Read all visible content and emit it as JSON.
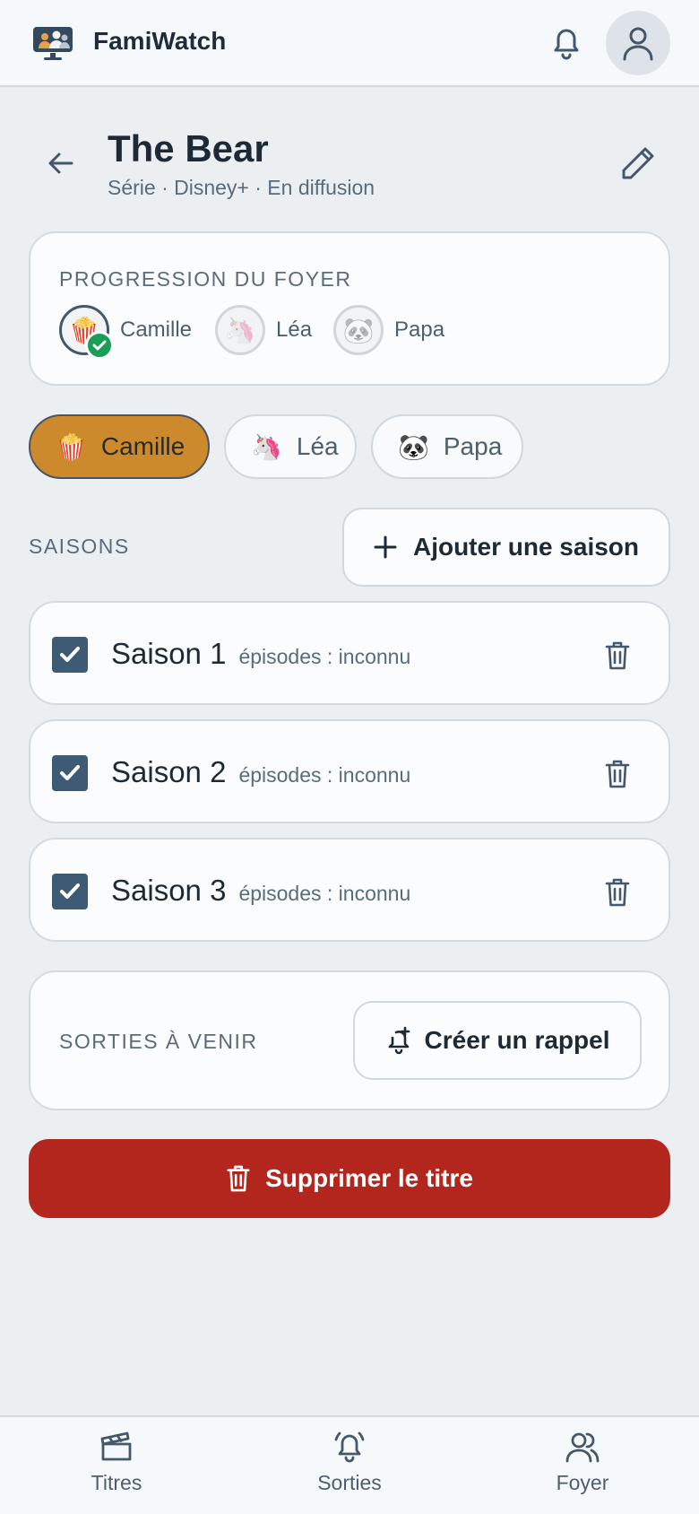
{
  "app": {
    "name": "FamiWatch"
  },
  "icons": {
    "logo": "family-tv-icon",
    "notifications": "bell-icon",
    "profile": "user-icon",
    "back": "arrow-left-icon",
    "edit": "pencil-icon"
  },
  "title": {
    "name": "The Bear",
    "meta": "Série · Disney+ · En diffusion"
  },
  "progress": {
    "label": "PROGRESSION DU FOYER",
    "members": [
      {
        "name": "Camille",
        "emoji": "🍿",
        "done": true
      },
      {
        "name": "Léa",
        "emoji": "🦄",
        "done": false
      },
      {
        "name": "Papa",
        "emoji": "🐼",
        "done": false
      }
    ]
  },
  "profiles": [
    {
      "name": "Camille",
      "emoji": "🍿",
      "selected": true
    },
    {
      "name": "Léa",
      "emoji": "🦄",
      "selected": false
    },
    {
      "name": "Papa",
      "emoji": "🐼",
      "selected": false
    }
  ],
  "seasons": {
    "label": "SAISONS",
    "add_label": "Ajouter une saison",
    "items": [
      {
        "name": "Saison 1",
        "episodes": "épisodes : inconnu",
        "checked": true
      },
      {
        "name": "Saison 2",
        "episodes": "épisodes : inconnu",
        "checked": true
      },
      {
        "name": "Saison 3",
        "episodes": "épisodes : inconnu",
        "checked": true
      }
    ]
  },
  "upcoming": {
    "label": "SORTIES À VENIR",
    "reminder_label": "Créer un rappel"
  },
  "delete": {
    "label": "Supprimer le titre",
    "color": "#b3261e"
  },
  "nav": {
    "items": [
      {
        "label": "Titres",
        "icon": "clapperboard-icon"
      },
      {
        "label": "Sorties",
        "icon": "bell-ring-icon"
      },
      {
        "label": "Foyer",
        "icon": "users-icon"
      }
    ]
  },
  "colors": {
    "accent": "#cd8a2d",
    "check": "#3f5a74",
    "done": "#1a9d55"
  }
}
